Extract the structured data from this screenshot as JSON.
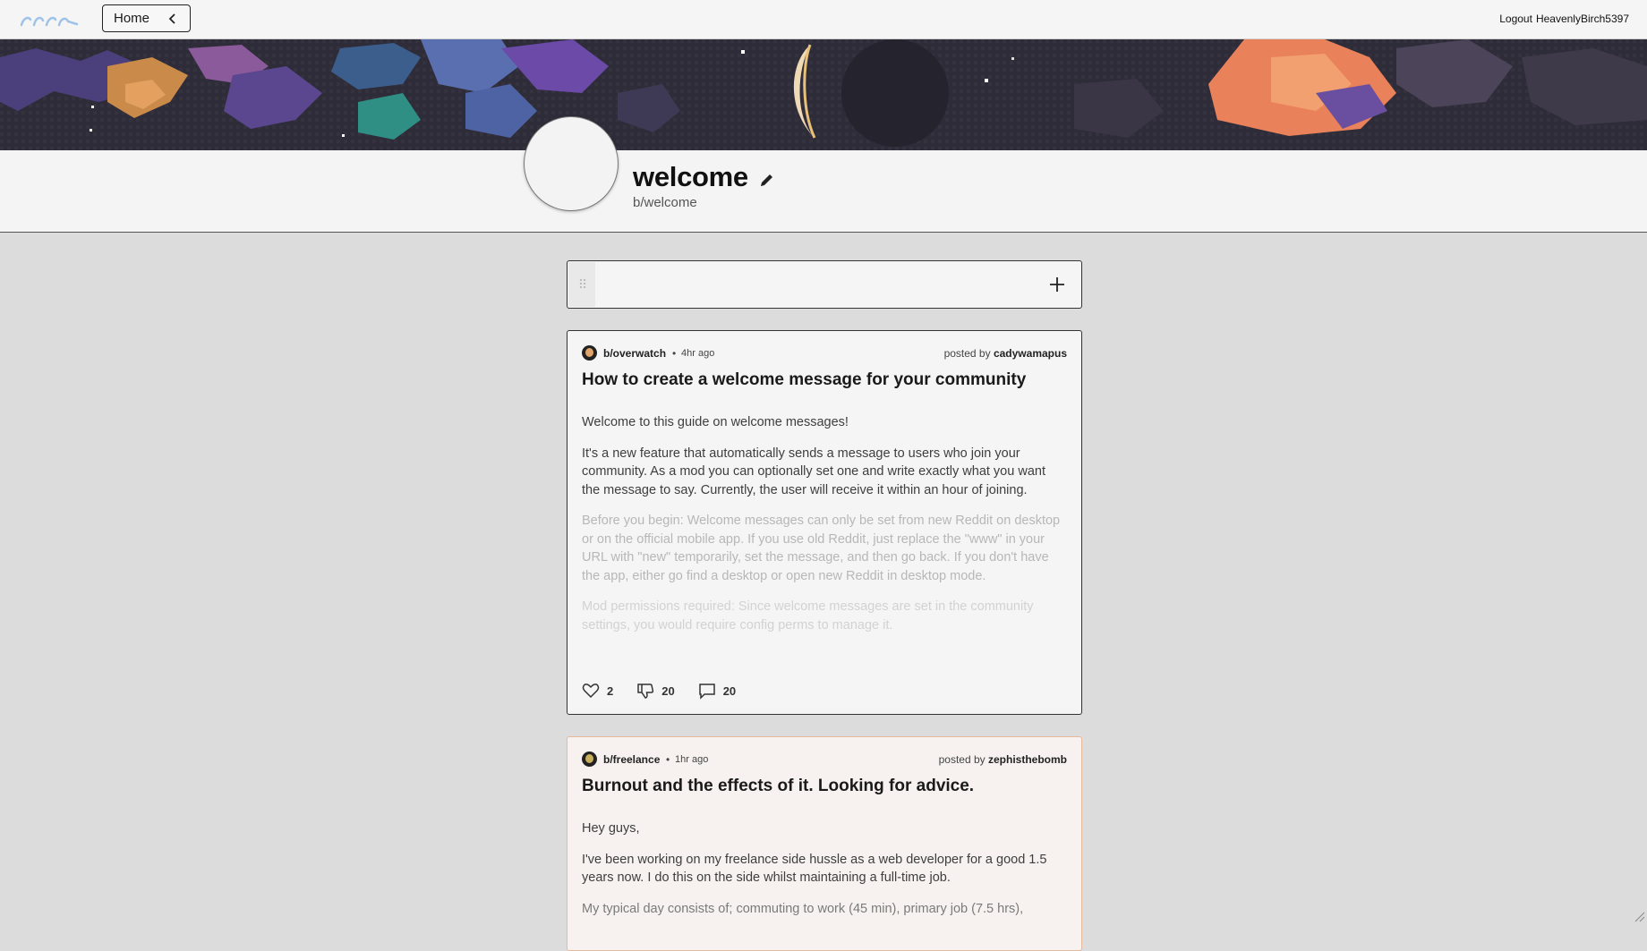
{
  "topbar": {
    "home_label": "Home",
    "logout_label": "Logout",
    "username": "HeavenlyBirch5397"
  },
  "community": {
    "title": "welcome",
    "handle": "b/welcome"
  },
  "composer": {
    "placeholder": ""
  },
  "posts": [
    {
      "subreddit": "b/overwatch",
      "age": "4hr ago",
      "posted_by_label": "posted by",
      "author": "cadywamapus",
      "title": "How to create a welcome message for your community",
      "paragraphs": [
        "Welcome to this guide on welcome messages!",
        "It's a new feature that automatically sends a message to users who join your community. As a mod you can optionally set one and write exactly what you want the message to say. Currently, the user will receive it within an hour of joining.",
        "Before you begin: Welcome messages can only be set from new Reddit on desktop or on the official mobile app. If you use old Reddit, just replace the \"www\" in your URL with \"new\" temporarily, set the message, and then go back. If you don't have the app, either go find a desktop or open new Reddit in desktop mode.",
        "Mod permissions required: Since welcome messages are set in the community settings, you would require config perms to manage it."
      ],
      "likes": "2",
      "dislikes": "20",
      "comments": "20"
    },
    {
      "subreddit": "b/freelance",
      "age": "1hr ago",
      "posted_by_label": "posted by",
      "author": "zephisthebomb",
      "title": "Burnout and the effects of it. Looking for advice.",
      "paragraphs": [
        "Hey guys,",
        "I've been working on my freelance side hussle as a web developer for a good 1.5 years now. I do this on the side whilst maintaining a full-time job.",
        "My typical day consists of; commuting to work (45 min), primary job (7.5 hrs),"
      ]
    }
  ],
  "colors": {
    "page_bg": "#dcdcdc",
    "card_bg": "#f5f5f5",
    "second_card_border": "#e6b89c",
    "banner_accent_orange": "#e9825a",
    "banner_accent_purple": "#6a4fa0"
  }
}
